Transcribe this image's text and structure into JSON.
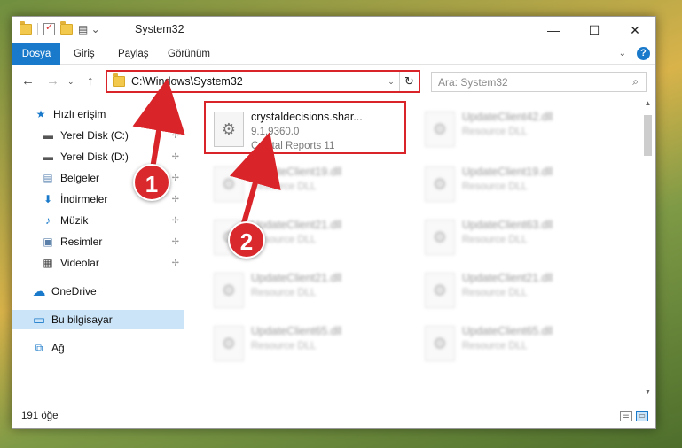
{
  "window": {
    "title": "System32"
  },
  "controls": {
    "minimize": "—",
    "maximize": "☐",
    "close": "✕"
  },
  "ribbon": {
    "tabs": [
      "Dosya",
      "Giriş",
      "Paylaş",
      "Görünüm"
    ],
    "active_tab": "Dosya",
    "help_label": "?"
  },
  "nav": {
    "back": "←",
    "forward": "→",
    "up": "↑",
    "dropdown": "⌄",
    "address": "C:\\Windows\\System32",
    "refresh": "↻",
    "search_placeholder": "Ara: System32",
    "search_icon": "⌕"
  },
  "sidebar": {
    "items": [
      {
        "label": "Hızlı erişim",
        "icon": "star-icon",
        "glyph": "★",
        "color": "#1979ca",
        "pinned": false
      },
      {
        "label": "Yerel Disk (C:)",
        "icon": "drive-icon",
        "glyph": "▬",
        "color": "#555555",
        "pinned": true
      },
      {
        "label": "Yerel Disk (D:)",
        "icon": "drive-icon",
        "glyph": "▬",
        "color": "#555555",
        "pinned": true
      },
      {
        "label": "Belgeler",
        "icon": "documents-icon",
        "glyph": "▤",
        "color": "#6a8fb8",
        "pinned": true
      },
      {
        "label": "İndirmeler",
        "icon": "download-icon",
        "glyph": "⬇",
        "color": "#1979ca",
        "pinned": true
      },
      {
        "label": "Müzik",
        "icon": "music-icon",
        "glyph": "♪",
        "color": "#1979ca",
        "pinned": true
      },
      {
        "label": "Resimler",
        "icon": "pictures-icon",
        "glyph": "▣",
        "color": "#5a7fa8",
        "pinned": true
      },
      {
        "label": "Videolar",
        "icon": "videos-icon",
        "glyph": "▦",
        "color": "#444444",
        "pinned": true
      },
      {
        "label": "OneDrive",
        "icon": "cloud-icon",
        "glyph": "☁",
        "color": "#1979ca",
        "pinned": false
      },
      {
        "label": "Bu bilgisayar",
        "icon": "computer-icon",
        "glyph": "▭",
        "color": "#1979ca",
        "pinned": false
      },
      {
        "label": "Ağ",
        "icon": "network-icon",
        "glyph": "⧉",
        "color": "#1979ca",
        "pinned": false
      }
    ],
    "selected": "Bu bilgisayar",
    "pin_glyph": "📌"
  },
  "files": [
    {
      "name": "crystaldecisions.shar...",
      "line2": "9.1.9360.0",
      "line3": "Crystal Reports 11",
      "highlighted": true
    },
    {
      "name": "UpdateClient42.dll",
      "line2": "Resource DLL",
      "line3": "",
      "highlighted": false
    },
    {
      "name": "UpdateClient19.dll",
      "line2": "Resource DLL",
      "line3": "",
      "highlighted": false
    },
    {
      "name": "UpdateClient19.dll",
      "line2": "Resource DLL",
      "line3": "",
      "highlighted": false
    },
    {
      "name": "UpdateClient21.dll",
      "line2": "Resource DLL",
      "line3": "",
      "highlighted": false
    },
    {
      "name": "UpdateClient63.dll",
      "line2": "Resource DLL",
      "line3": "",
      "highlighted": false
    },
    {
      "name": "UpdateClient21.dll",
      "line2": "Resource DLL",
      "line3": "",
      "highlighted": false
    },
    {
      "name": "UpdateClient21.dll",
      "line2": "Resource DLL",
      "line3": "",
      "highlighted": false
    },
    {
      "name": "UpdateClient65.dll",
      "line2": "Resource DLL",
      "line3": "",
      "highlighted": false
    },
    {
      "name": "UpdateClient65.dll",
      "line2": "Resource DLL",
      "line3": "",
      "highlighted": false
    }
  ],
  "file_icon_glyph": "⚙",
  "status": {
    "item_count": "191 öğe"
  },
  "annotations": {
    "marker1": "1",
    "marker2": "2",
    "color": "#d9252a"
  }
}
